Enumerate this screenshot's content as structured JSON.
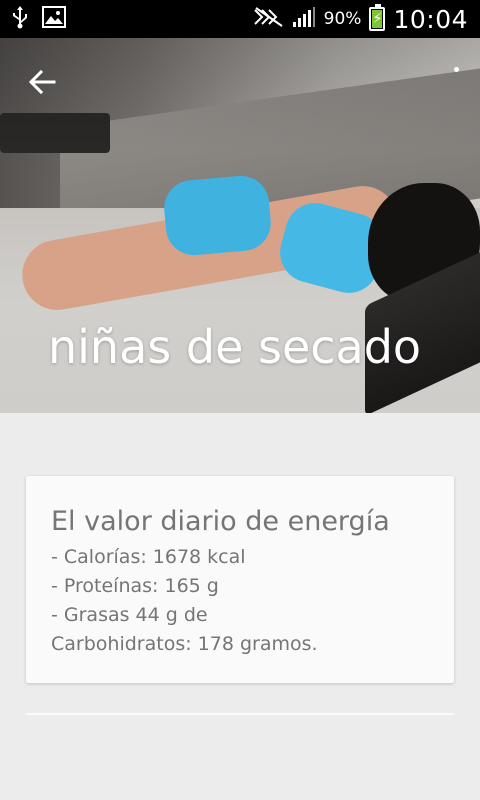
{
  "status_bar": {
    "battery_percent": "90%",
    "battery_level": 0.9,
    "time": "10:04",
    "icons": [
      "usb-icon",
      "image-icon",
      "no-sim-icon",
      "signal-icon",
      "battery-charging-icon"
    ]
  },
  "hero": {
    "title": "niñas de secado",
    "back_icon": "arrow-back-icon",
    "menu_icon": "overflow-menu-icon"
  },
  "card": {
    "title": "El valor diario de energía",
    "lines": [
      "- Calorías: 1678 kcal",
      "- Proteínas: 165 g",
      "- Grasas 44 g de",
      "Carbohidratos: 178 gramos."
    ]
  },
  "colors": {
    "status_bg": "#000000",
    "page_bg": "#ececec",
    "card_bg": "#fafafa",
    "card_text": "#757575",
    "battery_fill": "#7cc534",
    "clothing_blue": "#46b8e6"
  }
}
